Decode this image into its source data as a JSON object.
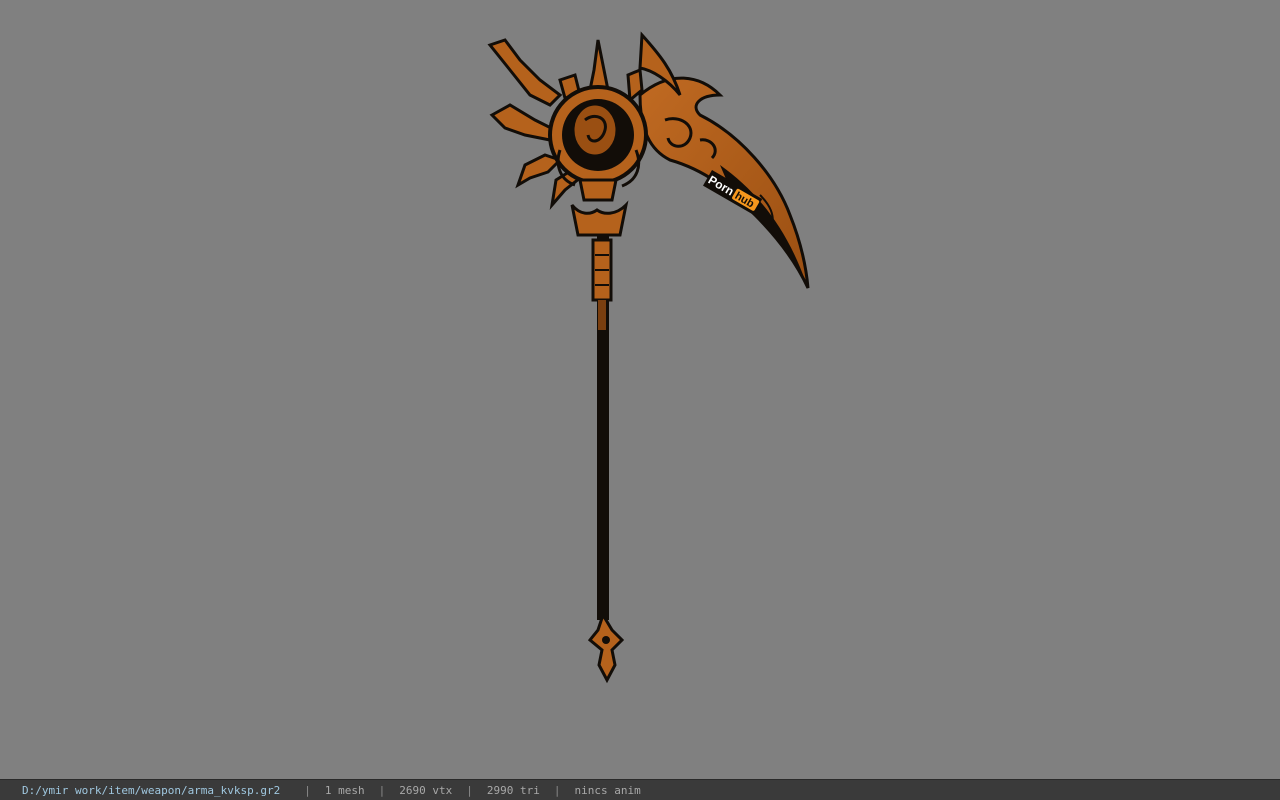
{
  "viewport": {
    "background_color": "#808080",
    "model": {
      "name": "scythe-weapon-model",
      "primary_color": "#b5621c",
      "dark_color": "#120d08",
      "decal_text_left": "Porn",
      "decal_text_right": "hub",
      "decal_accent_color": "#f7971d"
    }
  },
  "status_bar": {
    "file_path": "D:/ymir work/item/weapon/arma_kvksp.gr2",
    "separator": "|",
    "mesh_count": "1 mesh",
    "vertex_count": "2690 vtx",
    "triangle_count": "2990 tri",
    "animation": "nincs anim"
  }
}
